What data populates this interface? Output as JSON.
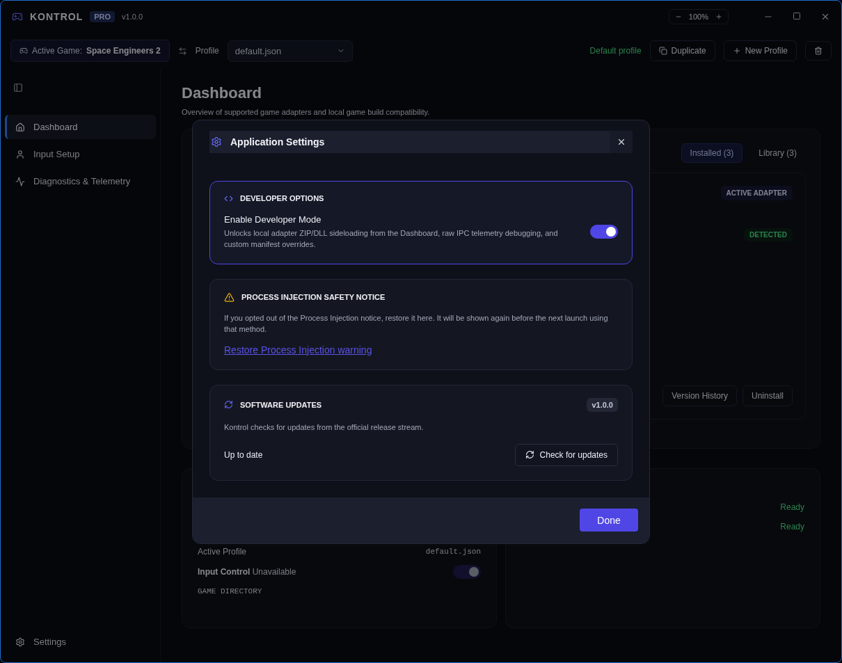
{
  "titlebar": {
    "app_name": "KONTROL",
    "badge": "PRO",
    "version": "v1.0.0",
    "zoom": "100%"
  },
  "toolbar": {
    "game_label": "Active Game:",
    "game": "Space Engineers 2",
    "profile_label": "Profile",
    "profile": "default.json",
    "status": "Default profile",
    "buttons": [
      "Duplicate",
      "New Profile"
    ]
  },
  "sidebar": {
    "items": [
      {
        "label": "Dashboard",
        "selected": true
      },
      {
        "label": "Input Setup",
        "selected": false
      },
      {
        "label": "Diagnostics & Telemetry",
        "selected": false
      }
    ],
    "footer": "Settings"
  },
  "page": {
    "title": "Dashboard",
    "subtitle": "Overview of supported game adapters and local game build compatibility.",
    "tabs": [
      {
        "label": "Installed (3)",
        "selected": true
      },
      {
        "label": "Library (3)",
        "selected": false
      }
    ],
    "adapter_badge": "ACTIVE ADAPTER",
    "detected_badge": "DETECTED",
    "adapter_buttons": [
      "Version History",
      "Uninstall"
    ],
    "statuses": [
      "Ready",
      "Ready"
    ],
    "profile_card": {
      "label": "Active Profile",
      "value": "default.json",
      "control_label": "Input Control",
      "control_state": "Unavailable",
      "control_on": true,
      "directory_label": "GAME DIRECTORY"
    }
  },
  "dialog": {
    "title": "Application Settings",
    "sections": [
      {
        "kind": "developer",
        "title": "DEVELOPER OPTIONS",
        "highlighted": true,
        "setting_label": "Enable Developer Mode",
        "setting_description": "Unlocks local adapter ZIP/DLL sideloading from the Dashboard, raw IPC telemetry debugging, and custom manifest overrides.",
        "on": true
      },
      {
        "kind": "notice",
        "title": "PROCESS INJECTION SAFETY NOTICE",
        "highlighted": false,
        "description": "If you opted out of the Process Injection notice, restore it here. It will be shown again before the next launch using that method.",
        "link": "Restore Process Injection warning"
      },
      {
        "kind": "updates",
        "title": "SOFTWARE UPDATES",
        "highlighted": false,
        "version": "v1.0.0",
        "description": "Kontrol checks for updates from the official release stream.",
        "status": "Up to date",
        "button": "Check for updates"
      }
    ],
    "done": "Done"
  }
}
